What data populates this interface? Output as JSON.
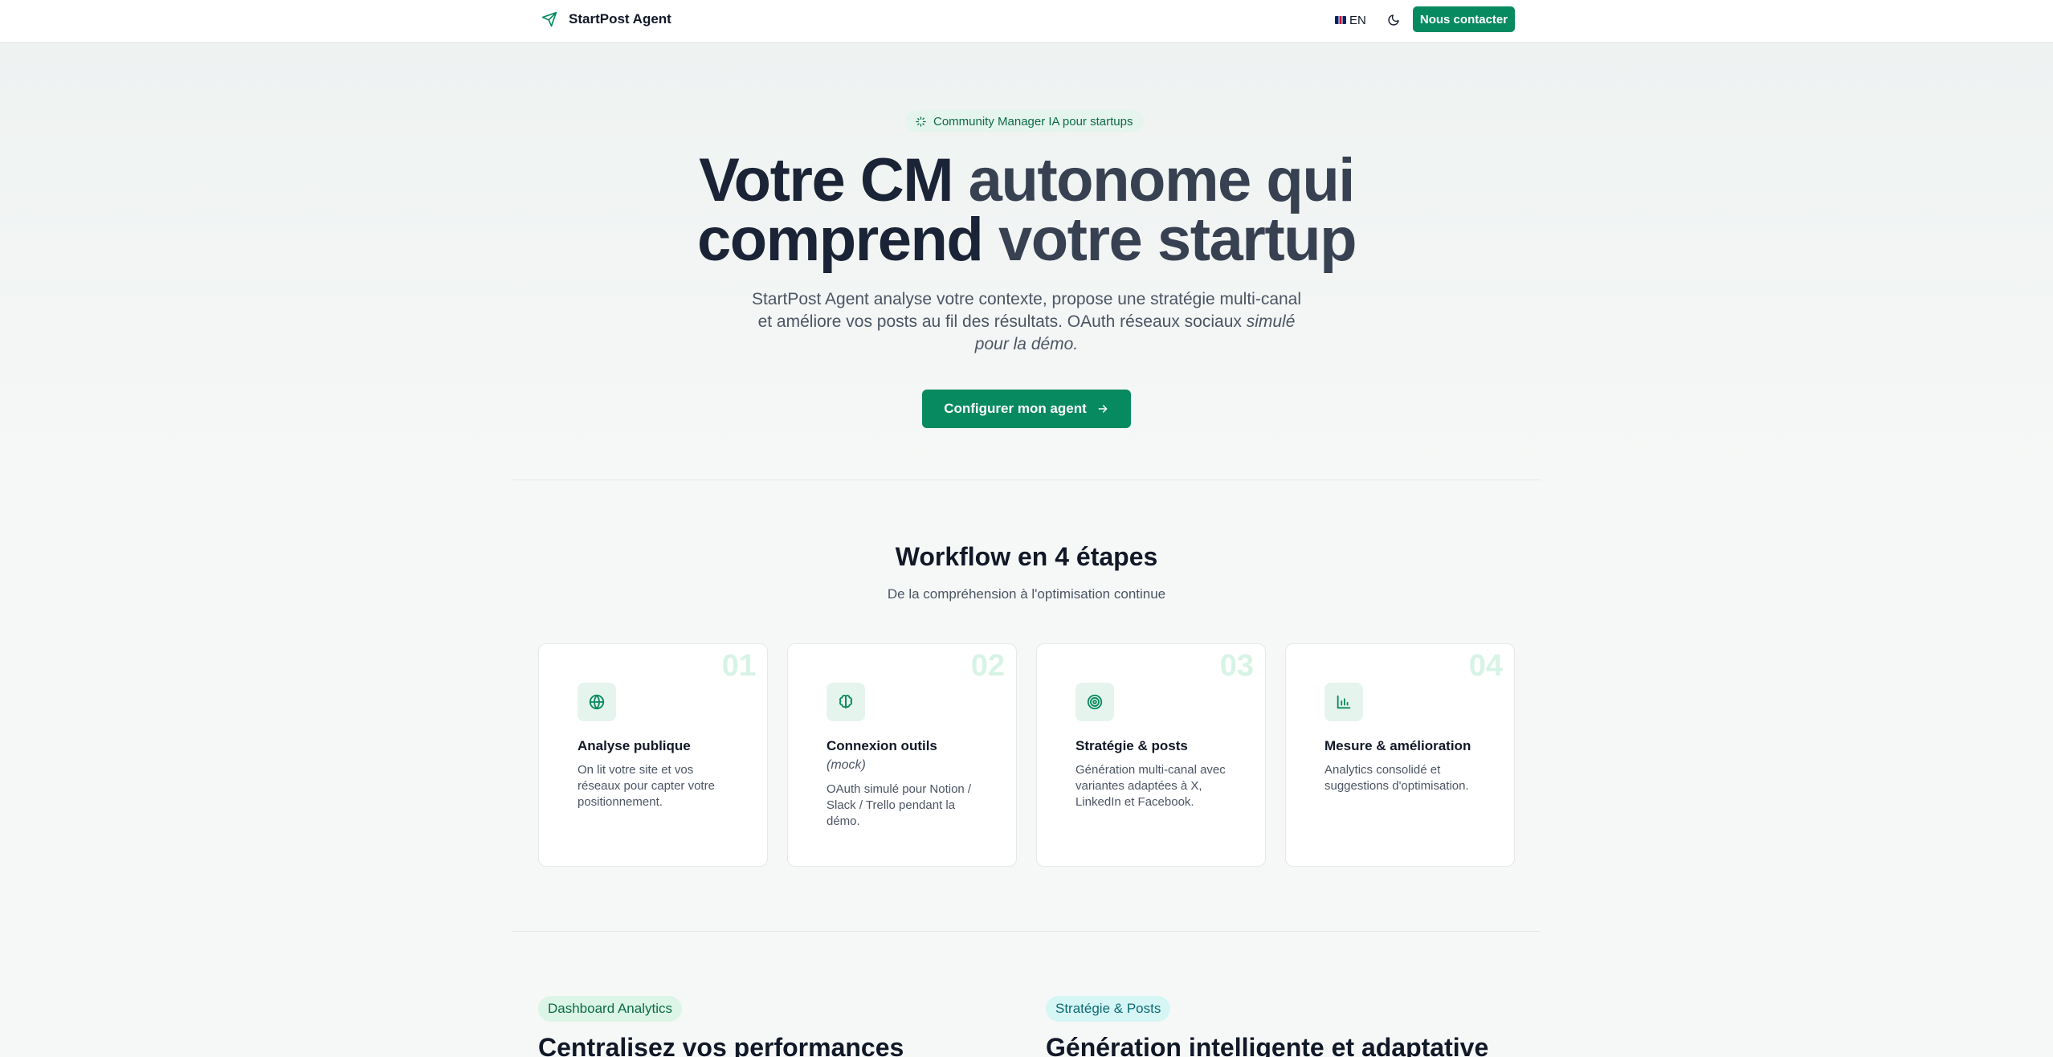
{
  "header": {
    "brand_name": "StartPost Agent",
    "brand_icon": "send-icon",
    "lang_label": "EN",
    "theme_icon": "moon-icon",
    "contact_label": "Nous contacter"
  },
  "hero": {
    "badge_icon": "sparkles-icon",
    "badge_label": "Community Manager IA pour startups",
    "title_line1_a": "Votre CM ",
    "title_line1_b": "autonome qui",
    "title_line2_a": "comprend ",
    "title_line2_b": "votre startup",
    "subtitle": "StartPost Agent analyse votre contexte, propose une stratégie multi-canal et améliore vos posts au fil des résultats. OAuth réseaux sociaux ",
    "subtitle_em": "simulé pour la démo.",
    "cta_label": "Configurer mon agent",
    "cta_icon": "arrow-right-icon"
  },
  "workflow": {
    "title": "Workflow en 4 étapes",
    "subtitle": "De la compréhension à l'optimisation continue",
    "steps": [
      {
        "number": "01",
        "icon": "globe-icon",
        "title": "Analyse publique",
        "mock": "",
        "description": "On lit votre site et vos réseaux pour capter votre positionnement."
      },
      {
        "number": "02",
        "icon": "brain-icon",
        "title": "Connexion outils",
        "mock": "(mock)",
        "description": "OAuth simulé pour Notion / Slack / Trello pendant la démo."
      },
      {
        "number": "03",
        "icon": "target-icon",
        "title": "Stratégie & posts",
        "mock": "",
        "description": "Génération multi-canal avec variantes adaptées à X, LinkedIn et Facebook."
      },
      {
        "number": "04",
        "icon": "bar-chart-icon",
        "title": "Mesure & amélioration",
        "mock": "",
        "description": "Analytics consolidé et suggestions d'optimisation."
      }
    ]
  },
  "sections": {
    "left_tag": "Dashboard Analytics",
    "left_title": "Centralisez vos performances",
    "right_tag": "Stratégie & Posts",
    "right_title": "Génération intelligente et adaptative"
  },
  "colors": {
    "accent": "#078a5f",
    "accent_light": "#e6f4ee",
    "text": "#111827",
    "muted": "#4b5563"
  }
}
